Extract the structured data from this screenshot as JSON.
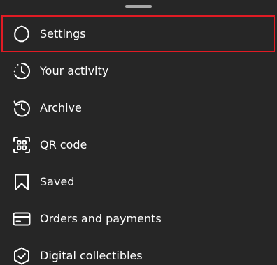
{
  "menu": {
    "items": [
      {
        "label": "Settings",
        "icon": "settings-gear-icon"
      },
      {
        "label": "Your activity",
        "icon": "activity-clock-icon"
      },
      {
        "label": "Archive",
        "icon": "archive-history-icon"
      },
      {
        "label": "QR code",
        "icon": "qr-code-icon"
      },
      {
        "label": "Saved",
        "icon": "bookmark-icon"
      },
      {
        "label": "Orders and payments",
        "icon": "credit-card-icon"
      },
      {
        "label": "Digital collectibles",
        "icon": "verified-shield-icon"
      }
    ]
  },
  "colors": {
    "background": "#262626",
    "text": "#ffffff",
    "handle": "#a8a8a8",
    "highlight_border": "#e01b24"
  }
}
